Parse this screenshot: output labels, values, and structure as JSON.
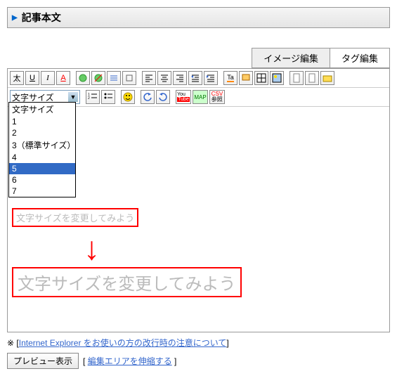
{
  "section_title": "記事本文",
  "tabs": {
    "image_edit": "イメージ編集",
    "tag_edit": "タグ編集"
  },
  "toolbar": {
    "bold": "太",
    "underline": "U",
    "italic": "I",
    "fontcolor": "A",
    "size_select_label": "文字サイズ",
    "csv": "CSV",
    "map": "MAP",
    "youtube": "You",
    "tube": "Tube",
    "ref": "参照",
    "tcolor": "Ta"
  },
  "font_size_options": [
    "文字サイズ",
    "1",
    "2",
    "3（標準サイズ）",
    "4",
    "5",
    "6",
    "7"
  ],
  "font_size_selected": "5",
  "sample_before": "文字サイズを変更してみよう",
  "sample_after": "文字サイズを変更してみよう",
  "footer": {
    "note_prefix": "※ [",
    "note_link": "Internet Explorer をお使いの方の改行時の注意について",
    "note_suffix": "]",
    "preview_button": "プレビュー表示",
    "expand_prefix": "[ ",
    "expand_link": "編集エリアを伸縮する",
    "expand_suffix": " ]"
  }
}
